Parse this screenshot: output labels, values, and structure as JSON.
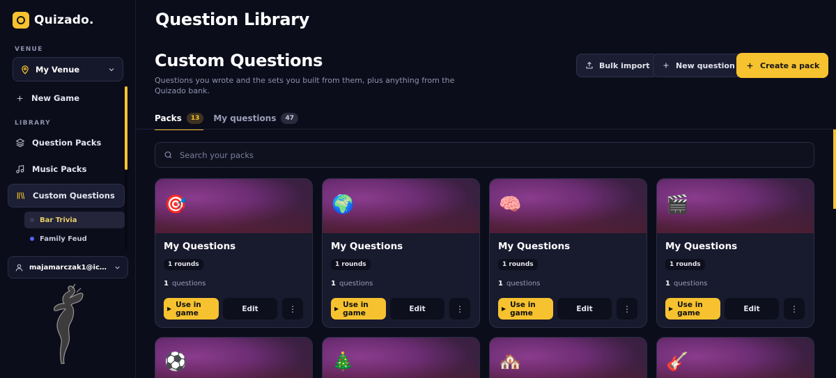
{
  "app": {
    "name": "Quizado."
  },
  "sidebar": {
    "venue_label": "VENUE",
    "venue_value": "My Venue",
    "new_game": "New Game",
    "library_label": "LIBRARY",
    "items": [
      {
        "label": "Question Packs"
      },
      {
        "label": "Music Packs"
      },
      {
        "label": "Custom Questions"
      }
    ],
    "sub_items": [
      {
        "label": "Bar Trivia",
        "color": "#3a3b55"
      },
      {
        "label": "Family Feud",
        "color": "#5a62f0"
      }
    ],
    "account_email": "majamarczak1@iclou..."
  },
  "main": {
    "page_title": "Question Library",
    "section_title": "Custom Questions",
    "section_subtitle": "Questions you wrote and the sets you built from them, plus anything from the Quizado bank.",
    "buttons": {
      "bulk_import": "Bulk import",
      "new_question": "New question",
      "create_pack": "Create a pack"
    },
    "tabs": [
      {
        "label": "Packs",
        "count": "13"
      },
      {
        "label": "My questions",
        "count": "47"
      }
    ],
    "search": {
      "placeholder": "Search your packs"
    },
    "cards": [
      {
        "emoji": "🎯",
        "title": "My Questions",
        "rounds": "1 rounds",
        "questions_count": "1",
        "questions_label": "questions",
        "use_label": "Use in game",
        "edit_label": "Edit"
      },
      {
        "emoji": "🌍",
        "title": "My Questions",
        "rounds": "1 rounds",
        "questions_count": "1",
        "questions_label": "questions",
        "use_label": "Use in game",
        "edit_label": "Edit"
      },
      {
        "emoji": "🧠",
        "title": "My Questions",
        "rounds": "1 rounds",
        "questions_count": "1",
        "questions_label": "questions",
        "use_label": "Use in game",
        "edit_label": "Edit"
      },
      {
        "emoji": "🎬",
        "title": "My Questions",
        "rounds": "1 rounds",
        "questions_count": "1",
        "questions_label": "questions",
        "use_label": "Use in game",
        "edit_label": "Edit"
      }
    ],
    "next_cards": [
      {
        "emoji": "⚽"
      },
      {
        "emoji": "🎄"
      },
      {
        "emoji": "🏘️"
      },
      {
        "emoji": "🎸"
      }
    ]
  },
  "colors": {
    "accent": "#f6c22f",
    "background": "#0c0d1b",
    "card": "#181a2e"
  }
}
